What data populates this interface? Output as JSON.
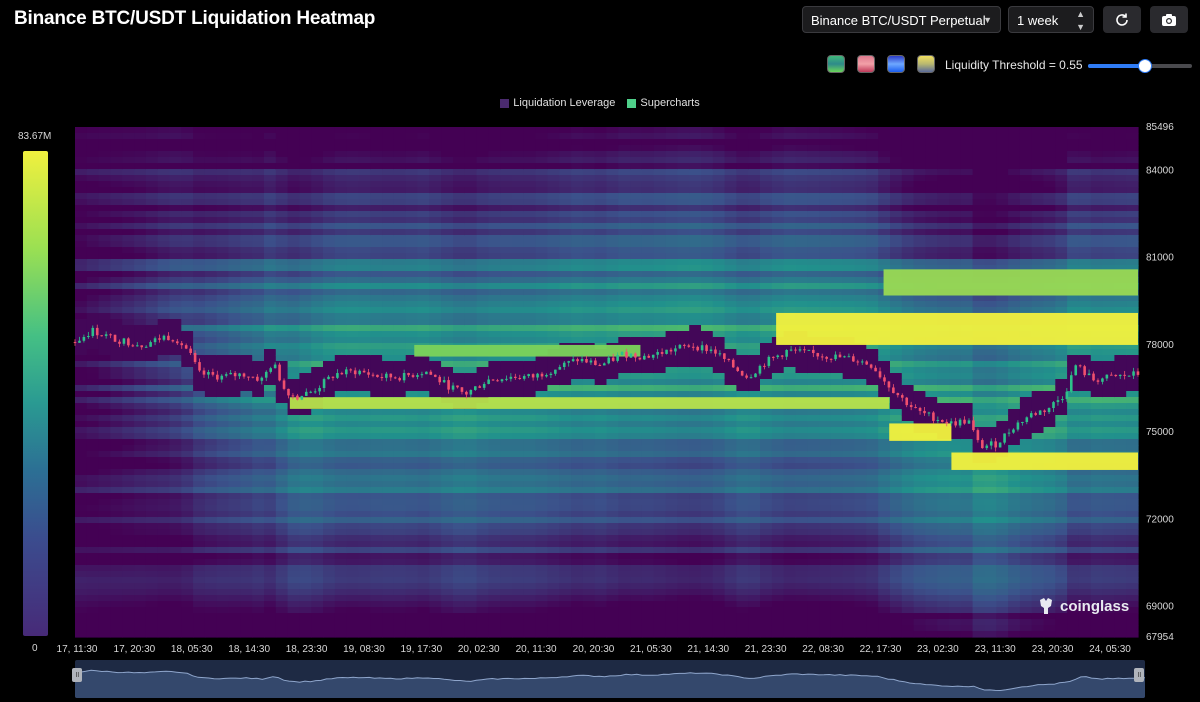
{
  "header": {
    "title": "Binance BTC/USDT Liquidation Heatmap",
    "pair_select": "Binance BTC/USDT Perpetual",
    "range_select": "1 week"
  },
  "controls": {
    "threshold_label": "Liquidity Threshold = 0.55",
    "threshold_value": 0.55,
    "swatches": [
      {
        "name": "viridis",
        "top": "#3fb87a",
        "bottom": "#6ad45a",
        "mid": "#2e8a8a"
      },
      {
        "name": "magma",
        "top": "#e07a8e",
        "bottom": "#c03a5a",
        "mid": "#f2a0a8"
      },
      {
        "name": "blue",
        "top": "#2c3cc8",
        "bottom": "#1a5ef0",
        "mid": "#6ea8ff"
      },
      {
        "name": "cividis",
        "top": "#f0e060",
        "bottom": "#5a6a9a",
        "mid": "#b8b870"
      }
    ]
  },
  "legend": {
    "items": [
      {
        "label": "Liquidation Leverage",
        "color": "#4a2a6e"
      },
      {
        "label": "Supercharts",
        "color": "#4fd08a"
      }
    ]
  },
  "scale": {
    "max_label": "83.67M",
    "min_label": "0"
  },
  "chart_data": {
    "type": "heatmap",
    "title": "Binance BTC/USDT Liquidation Heatmap",
    "y_ticks": [
      85496,
      84000,
      81000,
      78000,
      75000,
      72000,
      69000,
      67954
    ],
    "ylim": [
      67954,
      85496
    ],
    "x_ticks": [
      "17, 11:30",
      "17, 20:30",
      "18, 05:30",
      "18, 14:30",
      "18, 23:30",
      "19, 08:30",
      "19, 17:30",
      "20, 02:30",
      "20, 11:30",
      "20, 20:30",
      "21, 05:30",
      "21, 14:30",
      "21, 23:30",
      "22, 08:30",
      "22, 17:30",
      "23, 02:30",
      "23, 11:30",
      "23, 20:30",
      "24, 05:30"
    ],
    "liquidation_bands": [
      {
        "price_from": 78000,
        "price_to": 79100,
        "t_start": 12.4,
        "t_end": 18.8,
        "intensity": 1.0
      },
      {
        "price_from": 79700,
        "price_to": 80600,
        "t_start": 14.3,
        "t_end": 18.8,
        "intensity": 0.85
      },
      {
        "price_from": 75800,
        "price_to": 76200,
        "t_start": 3.8,
        "t_end": 14.4,
        "intensity": 0.9
      },
      {
        "price_from": 74700,
        "price_to": 75300,
        "t_start": 14.4,
        "t_end": 15.5,
        "intensity": 1.0
      },
      {
        "price_from": 73700,
        "price_to": 74300,
        "t_start": 15.5,
        "t_end": 18.8,
        "intensity": 1.0
      },
      {
        "price_from": 77600,
        "price_to": 78000,
        "t_start": 6.0,
        "t_end": 10.0,
        "intensity": 0.8
      }
    ],
    "price_series": [
      {
        "t": 0.0,
        "p": 78100
      },
      {
        "t": 0.3,
        "p": 78500
      },
      {
        "t": 0.7,
        "p": 78200
      },
      {
        "t": 1.2,
        "p": 78000
      },
      {
        "t": 1.6,
        "p": 78300
      },
      {
        "t": 1.8,
        "p": 78200
      },
      {
        "t": 2.0,
        "p": 77800
      },
      {
        "t": 2.2,
        "p": 77000
      },
      {
        "t": 2.6,
        "p": 76900
      },
      {
        "t": 3.0,
        "p": 77000
      },
      {
        "t": 3.3,
        "p": 76800
      },
      {
        "t": 3.5,
        "p": 77400
      },
      {
        "t": 3.7,
        "p": 76500
      },
      {
        "t": 3.9,
        "p": 76200
      },
      {
        "t": 4.2,
        "p": 76400
      },
      {
        "t": 4.6,
        "p": 77000
      },
      {
        "t": 5.0,
        "p": 77100
      },
      {
        "t": 5.4,
        "p": 76900
      },
      {
        "t": 5.8,
        "p": 76900
      },
      {
        "t": 6.2,
        "p": 77100
      },
      {
        "t": 6.5,
        "p": 76700
      },
      {
        "t": 6.9,
        "p": 76300
      },
      {
        "t": 7.3,
        "p": 76800
      },
      {
        "t": 7.7,
        "p": 76900
      },
      {
        "t": 8.1,
        "p": 76900
      },
      {
        "t": 8.5,
        "p": 77200
      },
      {
        "t": 8.9,
        "p": 77500
      },
      {
        "t": 9.3,
        "p": 77300
      },
      {
        "t": 9.7,
        "p": 77700
      },
      {
        "t": 10.1,
        "p": 77600
      },
      {
        "t": 10.5,
        "p": 77800
      },
      {
        "t": 10.9,
        "p": 78000
      },
      {
        "t": 11.3,
        "p": 77800
      },
      {
        "t": 11.6,
        "p": 77300
      },
      {
        "t": 11.9,
        "p": 76900
      },
      {
        "t": 12.2,
        "p": 77400
      },
      {
        "t": 12.6,
        "p": 77800
      },
      {
        "t": 13.0,
        "p": 77700
      },
      {
        "t": 13.4,
        "p": 77600
      },
      {
        "t": 13.8,
        "p": 77500
      },
      {
        "t": 14.1,
        "p": 77300
      },
      {
        "t": 14.3,
        "p": 76800
      },
      {
        "t": 14.6,
        "p": 76200
      },
      {
        "t": 14.9,
        "p": 75700
      },
      {
        "t": 15.2,
        "p": 75500
      },
      {
        "t": 15.5,
        "p": 75300
      },
      {
        "t": 15.8,
        "p": 75400
      },
      {
        "t": 16.0,
        "p": 74500
      },
      {
        "t": 16.3,
        "p": 74600
      },
      {
        "t": 16.6,
        "p": 75200
      },
      {
        "t": 16.9,
        "p": 75600
      },
      {
        "t": 17.2,
        "p": 75800
      },
      {
        "t": 17.5,
        "p": 76300
      },
      {
        "t": 17.7,
        "p": 77300
      },
      {
        "t": 18.0,
        "p": 76800
      },
      {
        "t": 18.4,
        "p": 76900
      },
      {
        "t": 18.8,
        "p": 77000
      }
    ]
  },
  "brand": {
    "name": "coinglass"
  }
}
